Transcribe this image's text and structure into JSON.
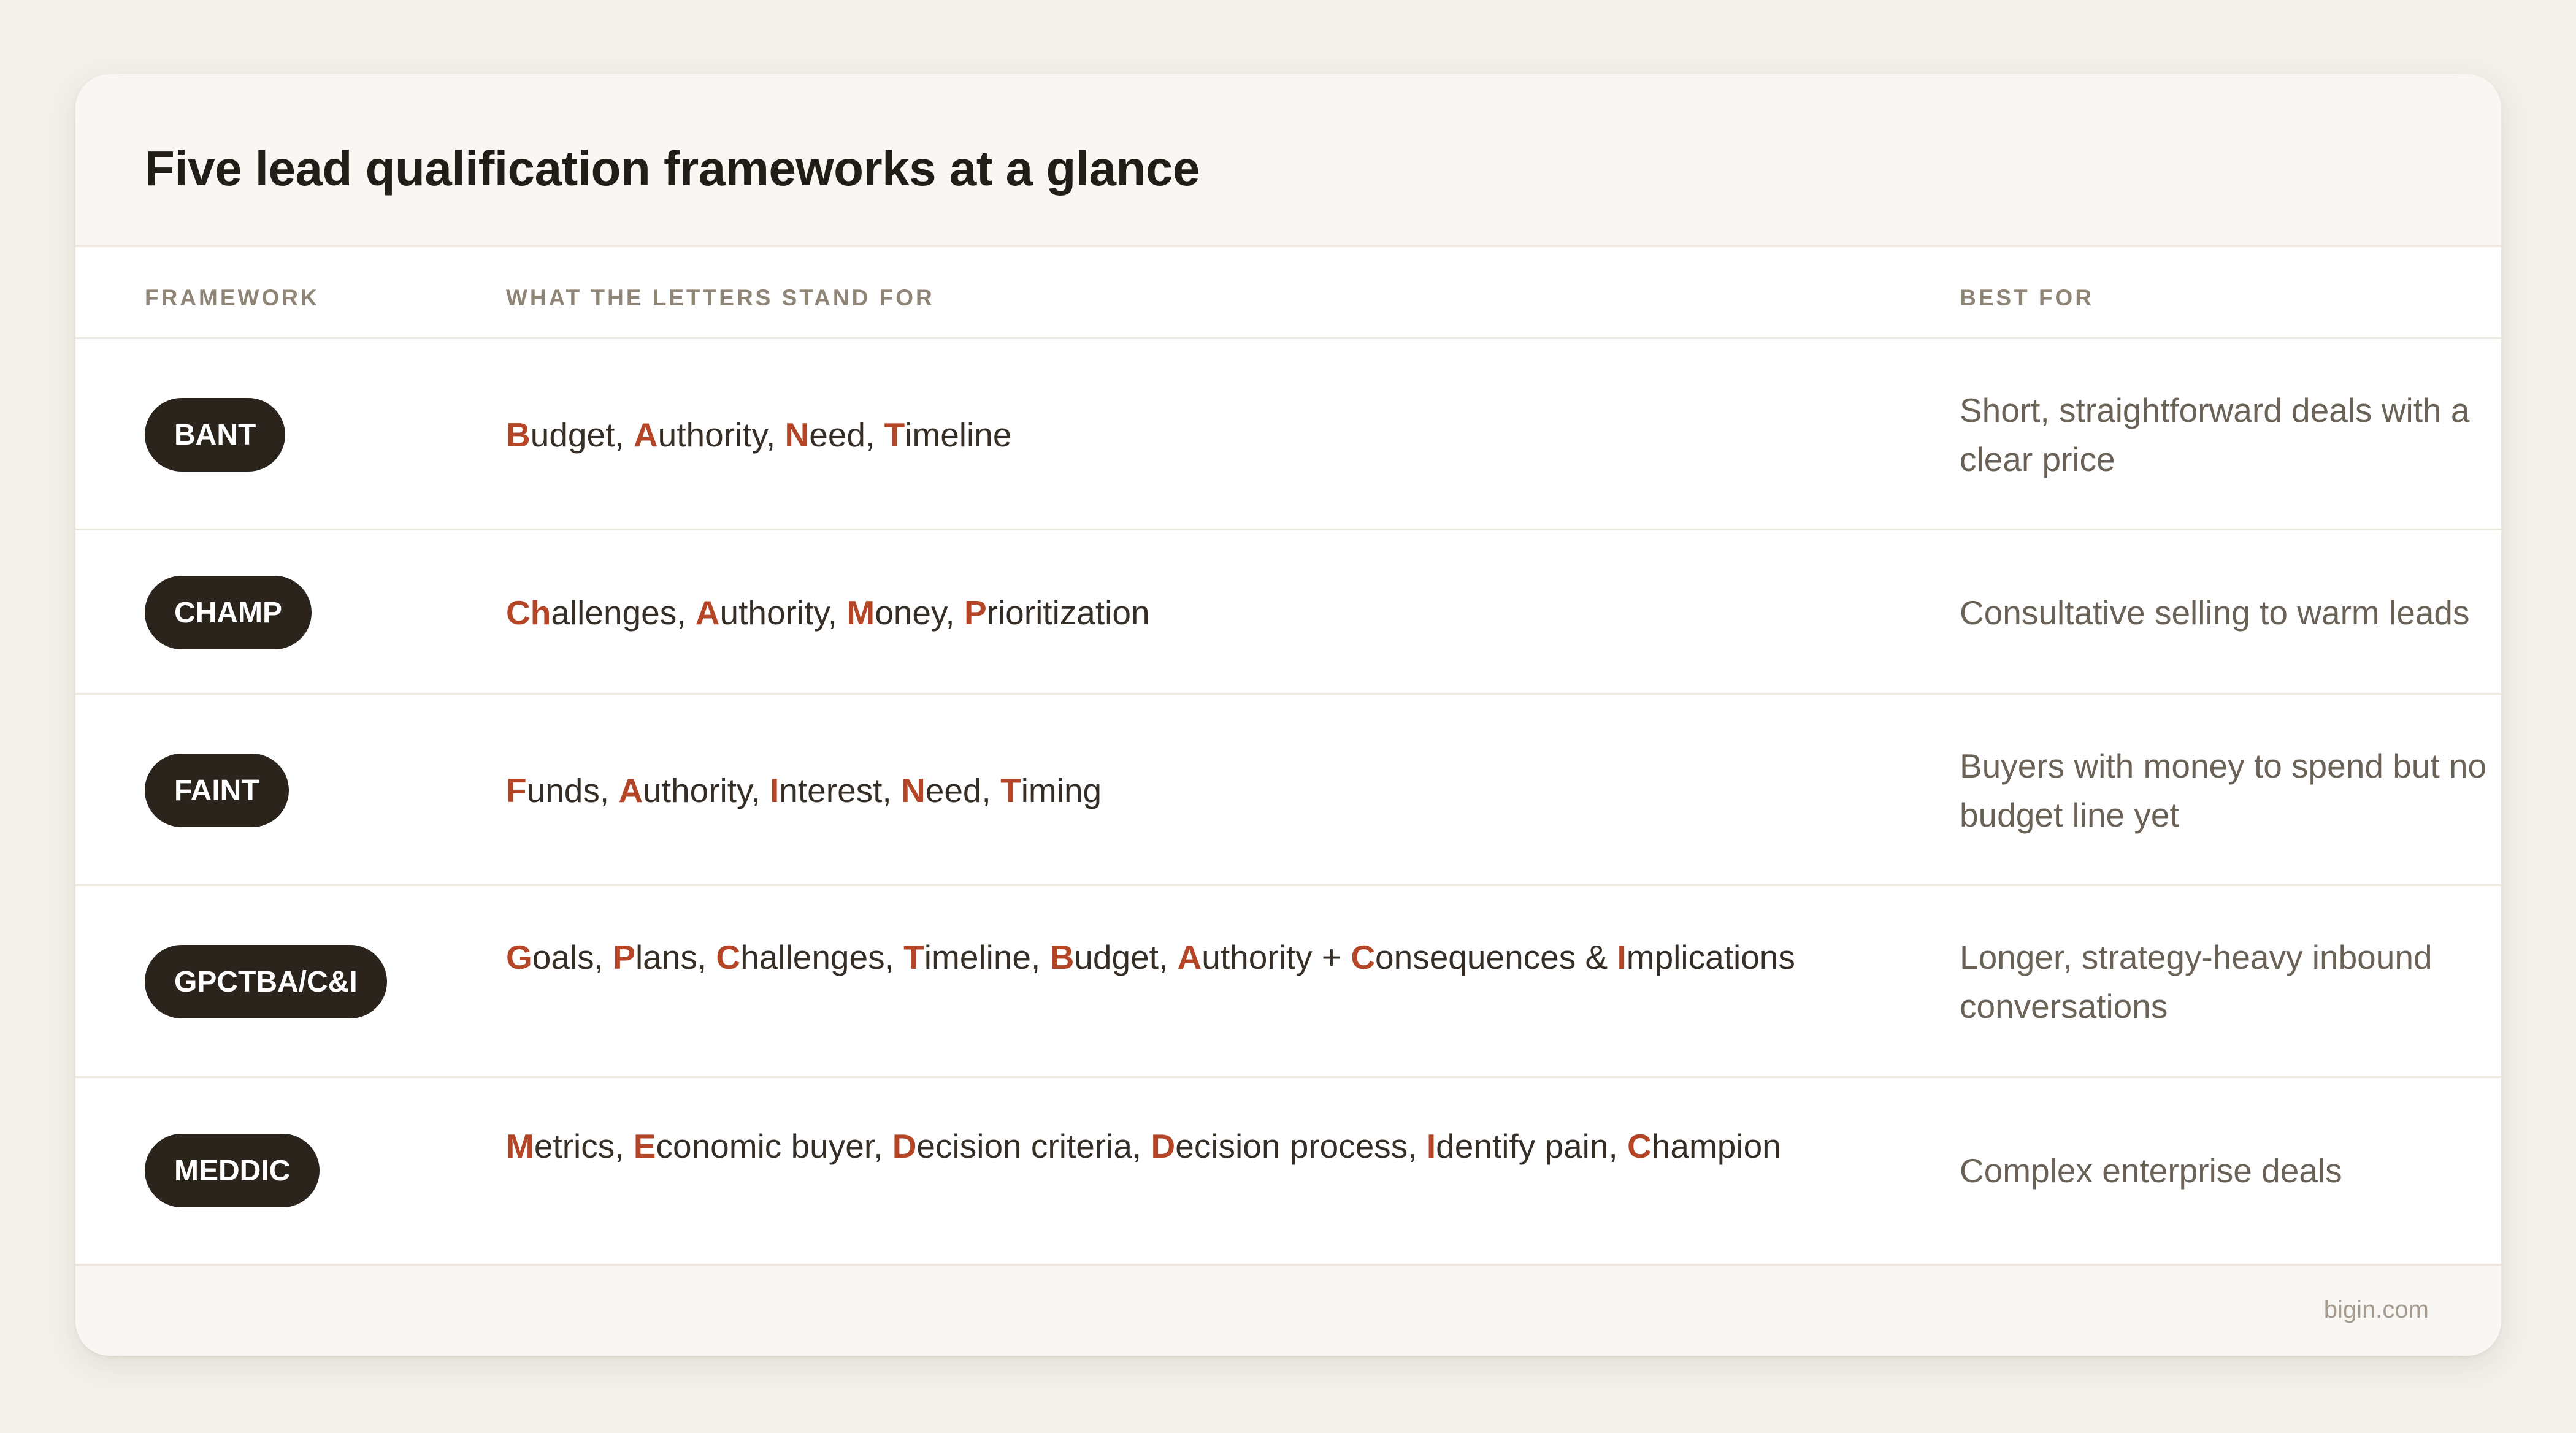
{
  "title": "Five lead qualification frameworks at a glance",
  "columns": {
    "framework": "FRAMEWORK",
    "letters": "WHAT THE LETTERS STAND FOR",
    "best_for": "BEST FOR"
  },
  "rows": [
    {
      "name": "BANT",
      "letters": [
        {
          "hl": "B",
          "rest": "udget, "
        },
        {
          "hl": "A",
          "rest": "uthority, "
        },
        {
          "hl": "N",
          "rest": "eed, "
        },
        {
          "hl": "T",
          "rest": "imeline"
        }
      ],
      "best_for": "Short, straightforward deals with a clear price"
    },
    {
      "name": "CHAMP",
      "letters": [
        {
          "hl": "Ch",
          "rest": "allenges, "
        },
        {
          "hl": "A",
          "rest": "uthority, "
        },
        {
          "hl": "M",
          "rest": "oney, "
        },
        {
          "hl": "P",
          "rest": "rioritization"
        }
      ],
      "best_for": "Consultative selling to warm leads"
    },
    {
      "name": "FAINT",
      "letters": [
        {
          "hl": "F",
          "rest": "unds, "
        },
        {
          "hl": "A",
          "rest": "uthority, "
        },
        {
          "hl": "I",
          "rest": "nterest, "
        },
        {
          "hl": "N",
          "rest": "eed, "
        },
        {
          "hl": "T",
          "rest": "iming"
        }
      ],
      "best_for": "Buyers with money to spend but no budget line yet"
    },
    {
      "name": "GPCTBA/C&I",
      "letters": [
        {
          "hl": "G",
          "rest": "oals, "
        },
        {
          "hl": "P",
          "rest": "lans, "
        },
        {
          "hl": "C",
          "rest": "hallenges, "
        },
        {
          "hl": "T",
          "rest": "imeline, "
        },
        {
          "hl": "B",
          "rest": "udget, "
        },
        {
          "hl": "A",
          "rest": "uthority + "
        },
        {
          "hl": "C",
          "rest": "onsequences & "
        },
        {
          "hl": "I",
          "rest": "mplications"
        }
      ],
      "best_for": "Longer, strategy-heavy inbound conversations"
    },
    {
      "name": "MEDDIC",
      "letters": [
        {
          "hl": "M",
          "rest": "etrics, "
        },
        {
          "hl": "E",
          "rest": "conomic buyer, "
        },
        {
          "hl": "D",
          "rest": "ecision criteria, "
        },
        {
          "hl": "D",
          "rest": "ecision process, "
        },
        {
          "hl": "I",
          "rest": "dentify pain, "
        },
        {
          "hl": "C",
          "rest": "hampion"
        }
      ],
      "best_for": "Complex enterprise deals"
    }
  ],
  "source": "bigin.com",
  "colors": {
    "accent": "#b44627",
    "pill": "#2b241d",
    "background": "#f3f0ea"
  }
}
